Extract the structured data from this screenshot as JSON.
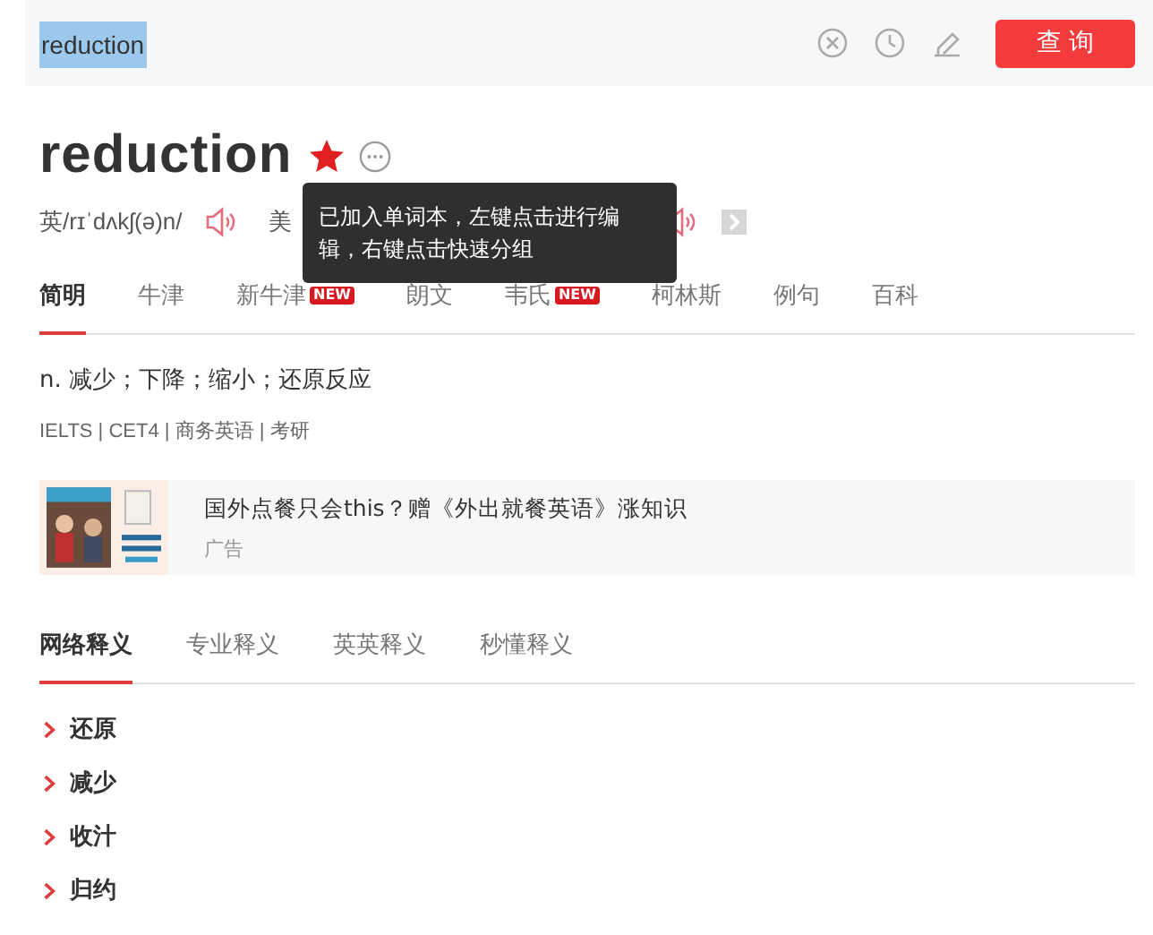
{
  "search": {
    "value": "reduction",
    "button": "查 询"
  },
  "word": {
    "headword": "reduction",
    "starred": true
  },
  "tooltip": {
    "text": "已加入单词本，左键点击进行编辑，右键点击快速分组"
  },
  "pronunciations": [
    {
      "label": "英",
      "phonetic": "/rɪˈdʌkʃ(ə)n/"
    },
    {
      "label": "美"
    }
  ],
  "dict_tabs": [
    {
      "label": "简明",
      "selected": true,
      "new": false
    },
    {
      "label": "牛津",
      "selected": false,
      "new": false
    },
    {
      "label": "新牛津",
      "selected": false,
      "new": true,
      "badge": "NEW"
    },
    {
      "label": "朗文",
      "selected": false,
      "new": false
    },
    {
      "label": "韦氏",
      "selected": false,
      "new": true,
      "badge": "NEW"
    },
    {
      "label": "柯林斯",
      "selected": false,
      "new": false
    },
    {
      "label": "例句",
      "selected": false,
      "new": false
    },
    {
      "label": "百科",
      "selected": false,
      "new": false
    }
  ],
  "definition": "n. 减少；下降；缩小；还原反应",
  "exams": "IELTS | CET4 | 商务英语 | 考研",
  "ad": {
    "title": "国外点餐只会this？赠《外出就餐英语》涨知识",
    "label": "广告"
  },
  "sense_tabs": [
    {
      "label": "网络释义",
      "selected": true
    },
    {
      "label": "专业释义",
      "selected": false
    },
    {
      "label": "英英释义",
      "selected": false
    },
    {
      "label": "秒懂释义",
      "selected": false
    }
  ],
  "web_senses": [
    "还原",
    "减少",
    "收汁",
    "归约"
  ]
}
